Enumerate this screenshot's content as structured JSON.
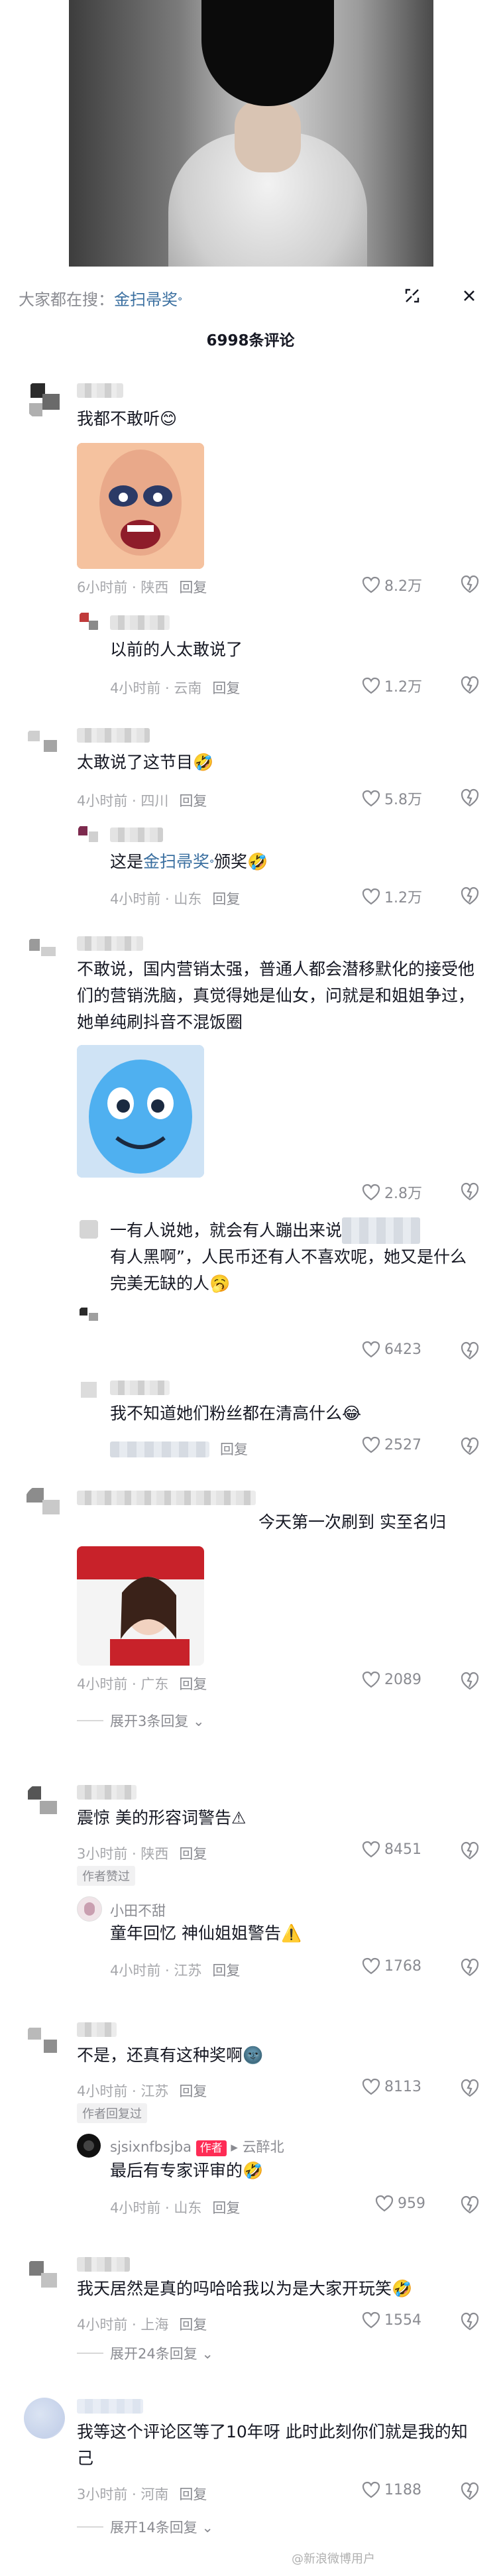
{
  "header": {
    "search_prefix": "大家都在搜：",
    "search_term": "金扫帚奖",
    "comment_count": "6998条评论"
  },
  "comments": [
    {
      "text": "我都不敢听😊",
      "time_loc": "6小时前 · 陕西",
      "reply": "回复",
      "likes": "8.2万"
    },
    {
      "text": "以前的人太敢说了",
      "time_loc": "4小时前 · 云南",
      "reply": "回复",
      "likes": "1.2万"
    },
    {
      "text": "太敢说了这节目🤣",
      "time_loc": "4小时前 · 四川",
      "reply": "回复",
      "likes": "5.8万"
    },
    {
      "text_before": "这是",
      "text_link": "金扫帚奖",
      "text_after": "颁奖🤣",
      "time_loc": "4小时前 · 山东",
      "reply": "回复",
      "likes": "1.2万"
    },
    {
      "text": "不敢说，国内营销太强，普通人都会潜移默化的接受他们的营销洗脑，真觉得她是仙女，问就是和姐姐争过，她单纯刷抖音不混饭圈",
      "likes": "2.8万"
    },
    {
      "text_a": "一有人说她，就会有人蹦出来说",
      "text_b": "有人黑啊”，人民币还有人不喜欢呢，她又是什么完美无缺的人🥱",
      "likes": "6423"
    },
    {
      "text": "我不知道她们粉丝都在清高什么😂",
      "reply": "回复",
      "likes": "2527"
    },
    {
      "text": "今天第一次刷到 实至名归",
      "time_loc": "4小时前 · 广东",
      "reply": "回复",
      "likes": "2089",
      "expand": "展开3条回复"
    },
    {
      "text": "震惊 美的形容词警告⚠",
      "time_loc": "3小时前 · 陕西",
      "reply": "回复",
      "likes": "8451",
      "badge": "作者赞过"
    },
    {
      "user": "小田不甜",
      "text": "童年回忆 神仙姐姐警告⚠️",
      "time_loc": "4小时前 · 江苏",
      "reply": "回复",
      "likes": "1768"
    },
    {
      "text": "不是，还真有这种奖啊🌚",
      "time_loc": "4小时前 · 江苏",
      "reply": "回复",
      "likes": "8113",
      "badge": "作者回复过"
    },
    {
      "user": "sjsixnfbsjba",
      "author_tag": "作者",
      "reply_to": "云醉北",
      "text": "最后有专家评审的🤣",
      "time_loc": "4小时前 · 山东",
      "reply": "回复",
      "likes": "959"
    },
    {
      "text": "我天居然是真的吗哈哈我以为是大家开玩笑🤣",
      "time_loc": "4小时前 · 上海",
      "reply": "回复",
      "likes": "1554",
      "expand": "展开24条回复"
    },
    {
      "text": "我等这个评论区等了10年呀 此时此刻你们就是我的知己",
      "time_loc": "3小时前 · 河南",
      "reply": "回复",
      "likes": "1188",
      "expand": "展开14条回复"
    }
  ],
  "watermark": "@新浪微博用户",
  "colors": {
    "link": "#3a6fa0",
    "author_tag": "#fe2c55",
    "meta": "#a6a7ab"
  }
}
